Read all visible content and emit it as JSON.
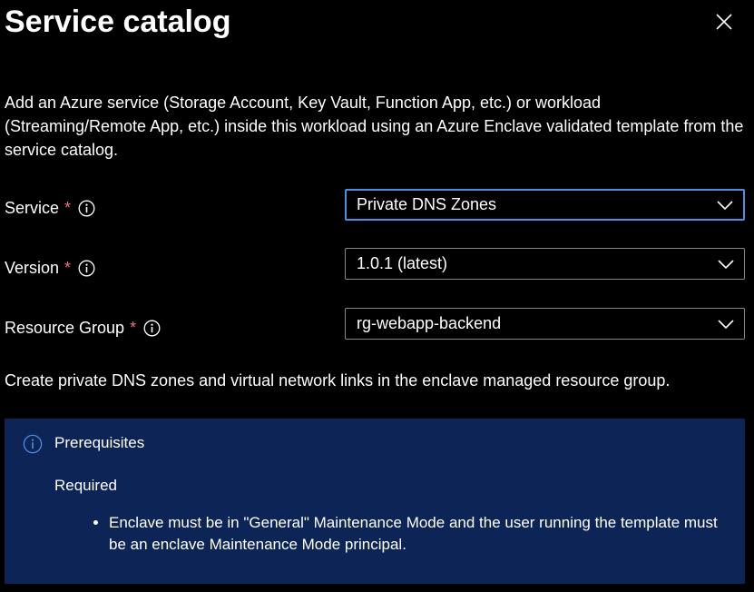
{
  "header": {
    "title": "Service catalog",
    "close_icon": "close-icon"
  },
  "description": "Add an Azure service (Storage Account, Key Vault, Function App, etc.) or workload (Streaming/Remote App, etc.) inside this workload using an Azure Enclave validated template from the service catalog.",
  "form": {
    "service": {
      "label": "Service",
      "required_mark": "*",
      "value": "Private DNS Zones",
      "focused": true
    },
    "version": {
      "label": "Version",
      "required_mark": "*",
      "value": "1.0.1 (latest)"
    },
    "resource_group": {
      "label": "Resource Group",
      "required_mark": "*",
      "value": "rg-webapp-backend"
    }
  },
  "summary": "Create private DNS zones and virtual network links in the enclave managed resource group.",
  "prerequisites": {
    "title": "Prerequisites",
    "subtitle": "Required",
    "items": [
      "Enclave must be in \"General\" Maintenance Mode and the user running the template must be an enclave Maintenance Mode principal."
    ]
  },
  "colors": {
    "background": "#000000",
    "required_star": "#f1707b",
    "focus_border": "#4f8fe3",
    "info_box_bg": "#0c2456",
    "info_icon_blue": "#4f8fe3"
  }
}
